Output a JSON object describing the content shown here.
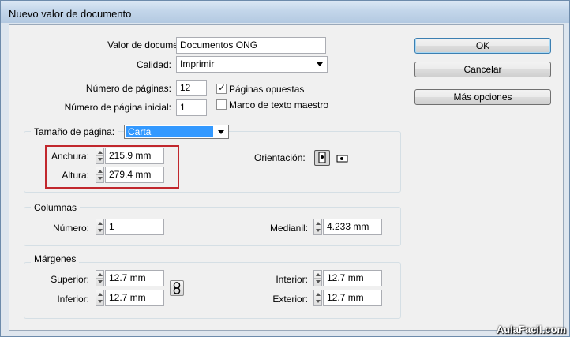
{
  "window": {
    "title": "Nuevo valor de documento"
  },
  "form": {
    "preset_label": "Valor de documento:",
    "preset_value": "Documentos ONG",
    "quality_label": "Calidad:",
    "quality_value": "Imprimir",
    "pages_label": "Número de páginas:",
    "pages_value": "12",
    "start_page_label": "Número de página inicial:",
    "start_page_value": "1",
    "facing_pages_label": "Páginas opuestas",
    "facing_pages_checked": true,
    "master_frame_label": "Marco de texto maestro",
    "master_frame_checked": false
  },
  "page_size": {
    "legend": "Tamaño de página:",
    "value": "Carta",
    "width_label": "Anchura:",
    "width_value": "215.9 mm",
    "height_label": "Altura:",
    "height_value": "279.4 mm",
    "orientation_label": "Orientación:"
  },
  "columns": {
    "legend": "Columnas",
    "number_label": "Número:",
    "number_value": "1",
    "gutter_label": "Medianil:",
    "gutter_value": "4.233 mm"
  },
  "margins": {
    "legend": "Márgenes",
    "top_label": "Superior:",
    "top_value": "12.7 mm",
    "bottom_label": "Inferior:",
    "bottom_value": "12.7 mm",
    "inside_label": "Interior:",
    "inside_value": "12.7 mm",
    "outside_label": "Exterior:",
    "outside_value": "12.7 mm"
  },
  "buttons": {
    "ok": "OK",
    "cancel": "Cancelar",
    "more": "Más opciones"
  },
  "watermark": "AulaFacil.com",
  "colors": {
    "highlight": "#3399ff",
    "annotation": "#c1272d"
  }
}
